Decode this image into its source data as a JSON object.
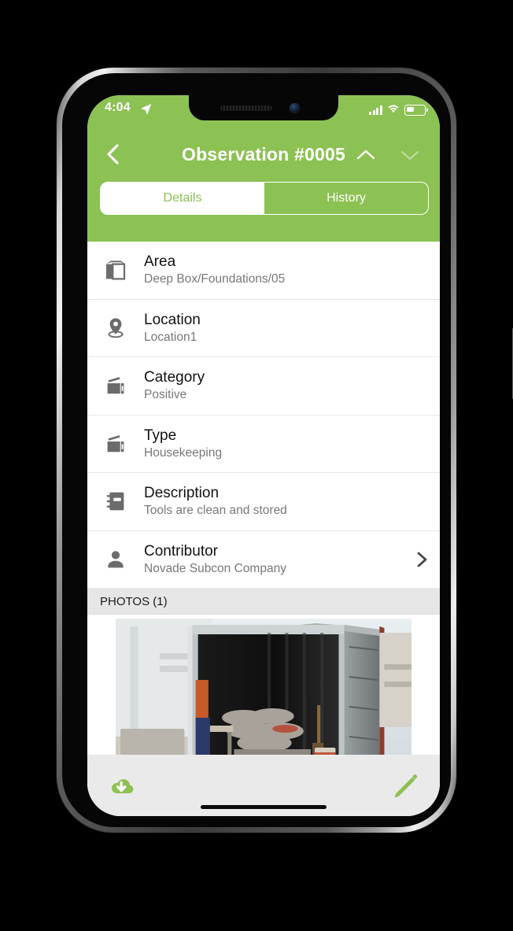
{
  "status_bar": {
    "time": "4:04",
    "location_icon": "location-arrow-icon",
    "signal_icon": "cellular-signal-icon",
    "wifi_icon": "wifi-icon",
    "battery_icon": "battery-icon",
    "battery_level_percent": 40
  },
  "header": {
    "title": "Observation #0005",
    "back_icon": "chevron-left-icon",
    "prev_icon": "chevron-up-icon",
    "next_icon": "chevron-down-icon",
    "background_color": "#8CC153",
    "tabs": [
      {
        "label": "Details",
        "selected": true
      },
      {
        "label": "History",
        "selected": false
      }
    ]
  },
  "details": {
    "rows": [
      {
        "icon": "box-icon",
        "label": "Area",
        "value": "Deep Box/Foundations/05",
        "chevron": false
      },
      {
        "icon": "map-pin-icon",
        "label": "Location",
        "value": "Location1",
        "chevron": false
      },
      {
        "icon": "folder-tag-icon",
        "label": "Category",
        "value": "Positive",
        "chevron": false
      },
      {
        "icon": "folder-tag-icon",
        "label": "Type",
        "value": "Housekeeping",
        "chevron": false
      },
      {
        "icon": "notebook-icon",
        "label": "Description",
        "value": "Tools are clean and stored",
        "chevron": false
      },
      {
        "icon": "person-icon",
        "label": "Contributor",
        "value": "Novade Subcon Company",
        "chevron": true
      }
    ]
  },
  "photos": {
    "section_title": "PHOTOS (1)",
    "count": 1,
    "items": [
      {
        "alt": "Open shipping container with stored tools, sandbags and a workbench on a construction site"
      }
    ]
  },
  "bottom_bar": {
    "download_icon": "cloud-download-icon",
    "edit_icon": "pencil-edit-icon",
    "accent_color": "#8CC153",
    "background_color": "#EAEAEA"
  },
  "device": {
    "home_indicator": "home-indicator",
    "notch": "notch",
    "speaker": "earpiece-speaker",
    "camera": "front-camera",
    "mute_switch": "mute-switch",
    "volume_up": "volume-up-button",
    "volume_down": "volume-down-button",
    "power": "power-button"
  }
}
